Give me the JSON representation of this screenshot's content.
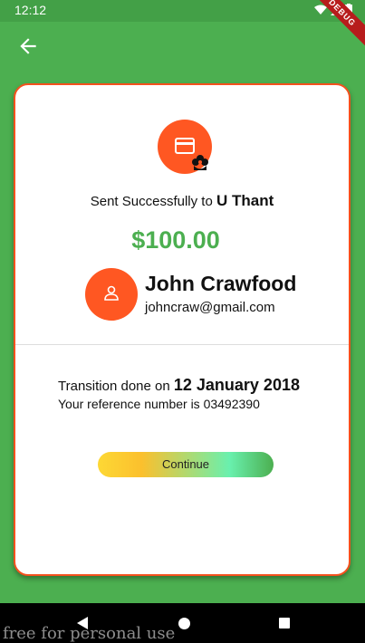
{
  "status_bar": {
    "time": "12:12",
    "ribbon": "DEBUG"
  },
  "icons": {
    "back": "arrow-left-icon",
    "card": "credit-card-icon",
    "badge": "flower-icon",
    "avatar": "person-icon"
  },
  "receipt": {
    "sent_prefix": "Sent Successfully to",
    "recipient": "U Thant",
    "amount": "$100.00",
    "user_name": "John Crawfood",
    "user_email": "johncraw@gmail.com",
    "transition_prefix": "Transition done on",
    "date": "12 January 2018",
    "reference_text": "Your reference number is 03492390",
    "continue_label": "Continue"
  },
  "watermark": "free for personal use",
  "colors": {
    "primary": "#4caf50",
    "accent": "#ff5722",
    "amount": "#4caf50"
  }
}
